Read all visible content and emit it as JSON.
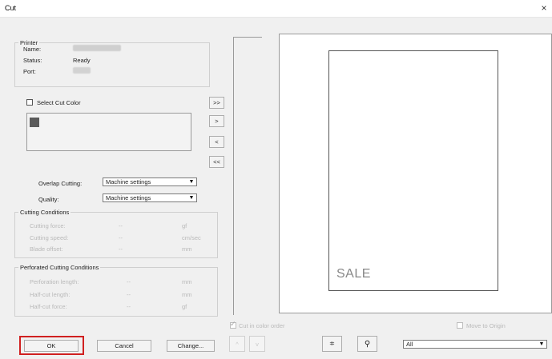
{
  "window": {
    "title": "Cut",
    "close_glyph": "×"
  },
  "printer": {
    "legend": "Printer",
    "name_label": "Name:",
    "status_label": "Status:",
    "status_value": "Ready",
    "port_label": "Port:"
  },
  "select_cut_color": {
    "label": "Select Cut Color",
    "checked": false
  },
  "move_buttons": {
    "add_all": ">>",
    "add": ">",
    "remove": "<",
    "remove_all": "<<"
  },
  "overlap_cutting": {
    "label": "Overlap Cutting:",
    "value": "Machine settings"
  },
  "quality": {
    "label": "Quality:",
    "value": "Machine settings"
  },
  "cutting_conditions": {
    "legend": "Cutting Conditions",
    "rows": [
      {
        "label": "Cutting force:",
        "value": "--",
        "unit": "gf"
      },
      {
        "label": "Cutting speed:",
        "value": "--",
        "unit": "cm/sec"
      },
      {
        "label": "Blade offset:",
        "value": "--",
        "unit": "mm"
      }
    ]
  },
  "perforated_conditions": {
    "legend": "Perforated Cutting Conditions",
    "rows": [
      {
        "label": "Perforation length:",
        "value": "--",
        "unit": "mm"
      },
      {
        "label": "Half-cut length:",
        "value": "--",
        "unit": "mm"
      },
      {
        "label": "Half-cut force:",
        "value": "--",
        "unit": "gf"
      }
    ]
  },
  "buttons": {
    "ok": "OK",
    "cancel": "Cancel",
    "change": "Change..."
  },
  "preview": {
    "page_text": "SALE"
  },
  "cut_in_color_order": {
    "label": "Cut in color order",
    "checked": true
  },
  "move_to_origin": {
    "label": "Move to Origin",
    "checked": false
  },
  "nav": {
    "up": "^",
    "down": "v"
  },
  "tools": {
    "fit": "⌗",
    "zoom": "⚲"
  },
  "page_select": {
    "value": "All"
  }
}
